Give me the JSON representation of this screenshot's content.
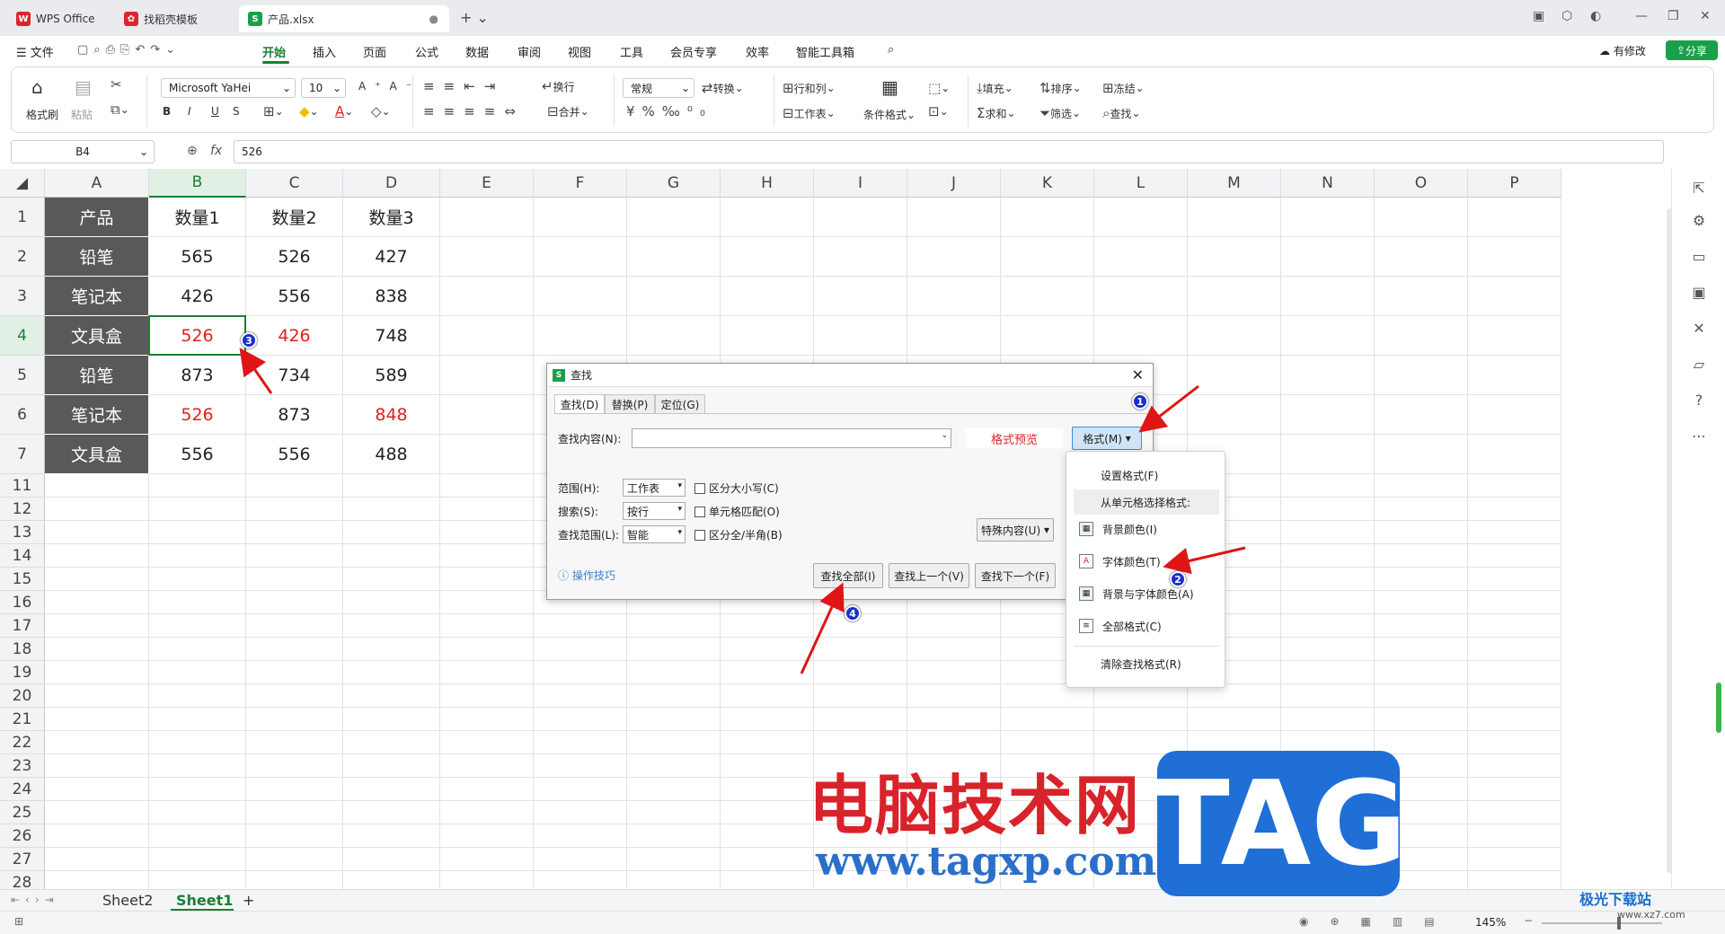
{
  "tabs": [
    {
      "label": "WPS Office",
      "color": "#d9272e"
    },
    {
      "label": "找稻壳模板",
      "color": "#d9272e"
    },
    {
      "label": "产品.xlsx",
      "color": "#1a9f4a"
    }
  ],
  "menu": {
    "file": "文件",
    "items": [
      "开始",
      "插入",
      "页面",
      "公式",
      "数据",
      "审阅",
      "视图",
      "工具",
      "会员专享",
      "效率",
      "智能工具箱"
    ],
    "active": "开始",
    "has_changes": "有修改",
    "share": "分享"
  },
  "ribbon": {
    "format_painter": "格式刷",
    "paste": "粘贴",
    "font_name": "Microsoft YaHei",
    "font_size": "10",
    "wrap": "换行",
    "merge": "合并",
    "number_format": "常规",
    "convert": "转换",
    "rows_cols": "行和列",
    "worksheet": "工作表",
    "conditional_format": "条件格式",
    "fill": "填充",
    "sort": "排序",
    "freeze": "冻结",
    "sum": "求和",
    "filter": "筛选",
    "find": "查找"
  },
  "formula_bar": {
    "name_box": "B4",
    "fx": "fx",
    "value": "526"
  },
  "grid": {
    "columns": [
      "A",
      "B",
      "C",
      "D",
      "E",
      "F",
      "G",
      "H",
      "I",
      "J",
      "K",
      "L",
      "M",
      "N",
      "O",
      "P"
    ],
    "rows_visible": [
      "1",
      "2",
      "3",
      "4",
      "5",
      "6",
      "7",
      "11",
      "12",
      "13",
      "14",
      "15",
      "16",
      "17",
      "18",
      "19",
      "20",
      "21",
      "22",
      "23",
      "24",
      "25",
      "26",
      "27",
      "28"
    ],
    "data": [
      [
        "产品",
        "数量1",
        "数量2",
        "数量3"
      ],
      [
        "铅笔",
        "565",
        "526",
        "427"
      ],
      [
        "笔记本",
        "426",
        "556",
        "838"
      ],
      [
        "文具盒",
        "526",
        "426",
        "748"
      ],
      [
        "铅笔",
        "873",
        "734",
        "589"
      ],
      [
        "笔记本",
        "526",
        "873",
        "848"
      ],
      [
        "文具盒",
        "556",
        "556",
        "488"
      ]
    ],
    "red_cells": [
      "B4",
      "C4",
      "B6",
      "D6"
    ],
    "selected_cell": "B4"
  },
  "sheets": [
    "Sheet2",
    "Sheet1"
  ],
  "active_sheet": "Sheet1",
  "status": {
    "zoom": "145%"
  },
  "dialog": {
    "title": "查找",
    "tabs": [
      "查找(D)",
      "替换(P)",
      "定位(G)"
    ],
    "find_label": "查找内容(N):",
    "find_value": "",
    "preview": "格式预览",
    "format_button": "格式(M)",
    "scope_label": "范围(H):",
    "scope_value": "工作表",
    "search_label": "搜索(S):",
    "search_value": "按行",
    "lookin_label": "查找范围(L):",
    "lookin_value": "智能",
    "opt_case": "区分大小写(C)",
    "opt_cell": "单元格匹配(O)",
    "opt_width": "区分全/半角(B)",
    "special": "特殊内容(U)",
    "tips": "操作技巧",
    "find_all": "查找全部(I)",
    "find_prev": "查找上一个(V)",
    "find_next": "查找下一个(F)"
  },
  "format_menu": {
    "items": [
      "设置格式(F)",
      "从单元格选择格式:",
      "背景颜色(I)",
      "字体颜色(T)",
      "背景与字体颜色(A)",
      "全部格式(C)",
      "清除查找格式(R)"
    ]
  },
  "annotations": [
    "1",
    "2",
    "3",
    "4"
  ],
  "watermark": {
    "title": "电脑技术网",
    "url": "www.tagxp.com",
    "tag": "TAG",
    "corner_logo": "极光下载站",
    "corner_url": "www.xz7.com"
  }
}
